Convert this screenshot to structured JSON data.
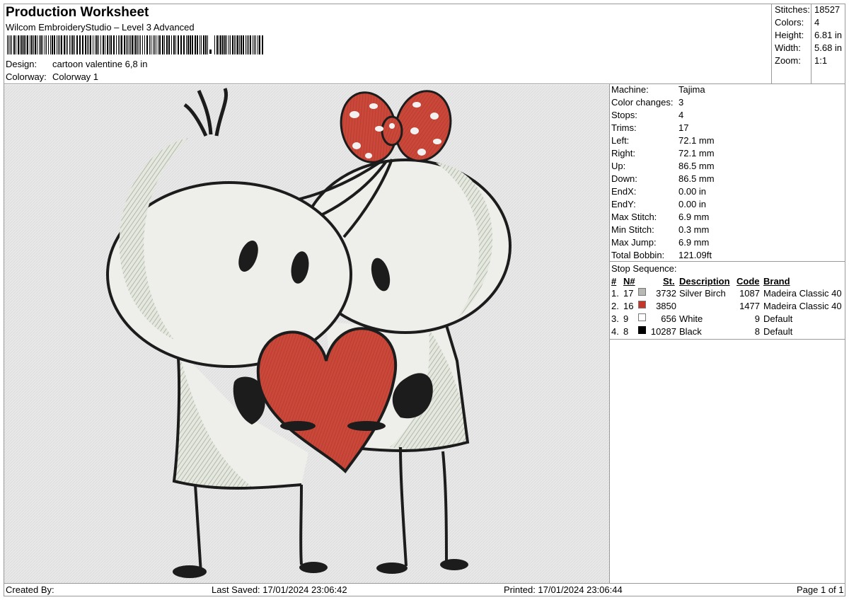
{
  "header": {
    "title": "Production Worksheet",
    "subtitle": "Wilcom EmbroideryStudio – Level 3 Advanced",
    "design_label": "Design:",
    "design_value": "cartoon valentine 6,8 in",
    "colorway_label": "Colorway:",
    "colorway_value": "Colorway 1"
  },
  "summary": [
    {
      "label": "Stitches:",
      "value": "18527"
    },
    {
      "label": "Colors:",
      "value": "4"
    },
    {
      "label": "Height:",
      "value": "6.81 in"
    },
    {
      "label": "Width:",
      "value": "5.68 in"
    },
    {
      "label": "Zoom:",
      "value": "1:1"
    }
  ],
  "machine_info": [
    {
      "label": "Machine:",
      "value": "Tajima"
    },
    {
      "label": "Color changes:",
      "value": "3"
    },
    {
      "label": "Stops:",
      "value": "4"
    },
    {
      "label": "Trims:",
      "value": "17"
    },
    {
      "label": "Left:",
      "value": "72.1 mm"
    },
    {
      "label": "Right:",
      "value": "72.1 mm"
    },
    {
      "label": "Up:",
      "value": "86.5 mm"
    },
    {
      "label": "Down:",
      "value": "86.5 mm"
    },
    {
      "label": "EndX:",
      "value": "0.00 in"
    },
    {
      "label": "EndY:",
      "value": "0.00 in"
    },
    {
      "label": "Max Stitch:",
      "value": "6.9 mm"
    },
    {
      "label": "Min Stitch:",
      "value": "0.3 mm"
    },
    {
      "label": "Max Jump:",
      "value": "6.9 mm"
    },
    {
      "label": "Total Bobbin:",
      "value": "121.09ft"
    }
  ],
  "stop_sequence": {
    "title": "Stop Sequence:",
    "headers": {
      "num": "#",
      "needle": "N#",
      "stitches": "St.",
      "description": "Description",
      "code": "Code",
      "brand": "Brand"
    },
    "rows": [
      {
        "num": "1.",
        "needle": "17",
        "color": "#b8b8b4",
        "stitches": "3732",
        "description": "Silver Birch",
        "code": "1087",
        "brand": "Madeira Classic 40"
      },
      {
        "num": "2.",
        "needle": "16",
        "color": "#c4352a",
        "stitches": "3850",
        "description": "",
        "code": "1477",
        "brand": "Madeira Classic 40"
      },
      {
        "num": "3.",
        "needle": "9",
        "color": "#ffffff",
        "stitches": "656",
        "description": "White",
        "code": "9",
        "brand": "Default"
      },
      {
        "num": "4.",
        "needle": "8",
        "color": "#000000",
        "stitches": "10287",
        "description": "Black",
        "code": "8",
        "brand": "Default"
      }
    ]
  },
  "footer": {
    "created_by": "Created By:",
    "last_saved": "Last Saved: 17/01/2024 23:06:42",
    "printed": "Printed: 17/01/2024 23:06:44",
    "page": "Page 1 of 1"
  }
}
